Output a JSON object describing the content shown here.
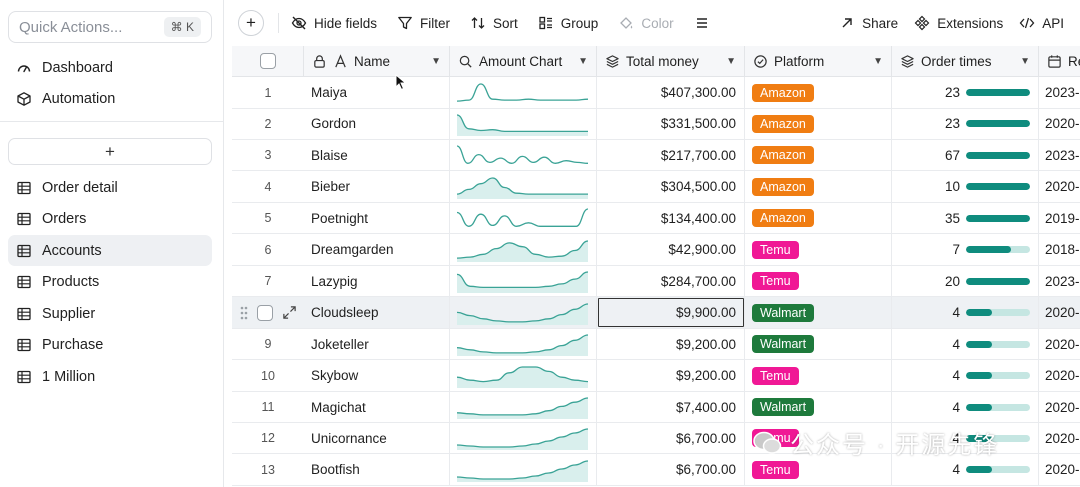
{
  "sidebar": {
    "quick_actions": "Quick Actions...",
    "shortcut": "⌘ K",
    "top_items": [
      {
        "label": "Dashboard",
        "icon": "gauge-icon"
      },
      {
        "label": "Automation",
        "icon": "cube-icon"
      }
    ],
    "add_label": "+",
    "tables": [
      {
        "label": "Order detail",
        "active": false
      },
      {
        "label": "Orders",
        "active": false
      },
      {
        "label": "Accounts",
        "active": true
      },
      {
        "label": "Products",
        "active": false
      },
      {
        "label": "Supplier",
        "active": false
      },
      {
        "label": "Purchase",
        "active": false
      },
      {
        "label": "1 Million",
        "active": false
      }
    ]
  },
  "toolbar": {
    "add_label": "+",
    "hide_fields": "Hide fields",
    "filter": "Filter",
    "sort": "Sort",
    "group": "Group",
    "color": "Color",
    "share": "Share",
    "extensions": "Extensions",
    "api": "API"
  },
  "columns": {
    "name": "Name",
    "amount_chart": "Amount Chart",
    "total_money": "Total money",
    "platform": "Platform",
    "order_times": "Order times",
    "date_partial": "Re"
  },
  "platform_colors": {
    "Amazon": "#f07d12",
    "Temu": "#f01895",
    "Walmart": "#1e7a3c"
  },
  "rows": [
    {
      "index": "1",
      "name": "Maiya",
      "money": "$407,300.00",
      "platform": "Amazon",
      "orders": "23",
      "order_fill": 1.0,
      "date": "2023-",
      "spark": [
        2,
        3,
        20,
        4,
        3,
        3,
        4,
        3,
        3,
        3,
        3,
        4
      ],
      "spark_area": false
    },
    {
      "index": "2",
      "name": "Gordon",
      "money": "$331,500.00",
      "platform": "Amazon",
      "orders": "23",
      "order_fill": 1.0,
      "date": "2020-",
      "spark": [
        22,
        6,
        4,
        5,
        3,
        3,
        3,
        3,
        3,
        3,
        3,
        3
      ],
      "spark_area": true
    },
    {
      "index": "3",
      "name": "Blaise",
      "money": "$217,700.00",
      "platform": "Amazon",
      "orders": "67",
      "order_fill": 1.0,
      "date": "2023-",
      "spark": [
        22,
        2,
        12,
        3,
        8,
        2,
        10,
        3,
        9,
        2,
        5,
        3,
        2
      ],
      "spark_area": false
    },
    {
      "index": "4",
      "name": "Bieber",
      "money": "$304,500.00",
      "platform": "Amazon",
      "orders": "10",
      "order_fill": 1.0,
      "date": "2020-",
      "spark": [
        3,
        8,
        14,
        20,
        10,
        4,
        3,
        3,
        3,
        3,
        3,
        3
      ],
      "spark_area": true
    },
    {
      "index": "5",
      "name": "Poetnight",
      "money": "$134,400.00",
      "platform": "Amazon",
      "orders": "35",
      "order_fill": 1.0,
      "date": "2019-",
      "spark": [
        18,
        2,
        16,
        3,
        14,
        2,
        6,
        2,
        2,
        2,
        2,
        22
      ],
      "spark_area": false
    },
    {
      "index": "6",
      "name": "Dreamgarden",
      "money": "$42,900.00",
      "platform": "Temu",
      "orders": "7",
      "order_fill": 0.7,
      "date": "2018-",
      "spark": [
        2,
        3,
        6,
        12,
        18,
        14,
        6,
        3,
        4,
        10,
        20
      ],
      "spark_area": true
    },
    {
      "index": "7",
      "name": "Lazypig",
      "money": "$284,700.00",
      "platform": "Temu",
      "orders": "20",
      "order_fill": 1.0,
      "date": "2023-",
      "spark": [
        14,
        4,
        3,
        3,
        3,
        3,
        3,
        4,
        6,
        10,
        16
      ],
      "spark_area": true
    },
    {
      "index": "8",
      "name": "Cloudsleep",
      "money": "$9,900.00",
      "platform": "Walmart",
      "orders": "4",
      "order_fill": 0.4,
      "date": "2020-",
      "spark": [
        10,
        7,
        4,
        2,
        1,
        1,
        2,
        4,
        8,
        13,
        18
      ],
      "spark_area": true
    },
    {
      "index": "9",
      "name": "Joketeller",
      "money": "$9,200.00",
      "platform": "Walmart",
      "orders": "4",
      "order_fill": 0.4,
      "date": "2020-",
      "spark": [
        6,
        4,
        2,
        1,
        1,
        1,
        2,
        4,
        8,
        13,
        18
      ],
      "spark_area": true
    },
    {
      "index": "10",
      "name": "Skybow",
      "money": "$9,200.00",
      "platform": "Temu",
      "orders": "4",
      "order_fill": 0.4,
      "date": "2020-",
      "spark": [
        6,
        4,
        3,
        4,
        9,
        13,
        13,
        10,
        6,
        4,
        3
      ],
      "spark_area": true
    },
    {
      "index": "11",
      "name": "Magichat",
      "money": "$7,400.00",
      "platform": "Walmart",
      "orders": "4",
      "order_fill": 0.4,
      "date": "2020-",
      "spark": [
        4,
        3,
        2,
        2,
        2,
        2,
        3,
        6,
        10,
        14,
        18
      ],
      "spark_area": true
    },
    {
      "index": "12",
      "name": "Unicornance",
      "money": "$6,700.00",
      "platform": "Temu",
      "orders": "4",
      "order_fill": 0.4,
      "date": "2020-",
      "spark": [
        3,
        2,
        1,
        1,
        1,
        2,
        4,
        7,
        11,
        15,
        19
      ],
      "spark_area": true
    },
    {
      "index": "13",
      "name": "Bootfish",
      "money": "$6,700.00",
      "platform": "Temu",
      "orders": "4",
      "order_fill": 0.4,
      "date": "2020-",
      "spark": [
        3,
        2,
        1,
        1,
        1,
        2,
        4,
        7,
        11,
        15,
        19
      ],
      "spark_area": true
    }
  ],
  "hovered_row": 7,
  "watermark": "公众号 · 开源先锋"
}
